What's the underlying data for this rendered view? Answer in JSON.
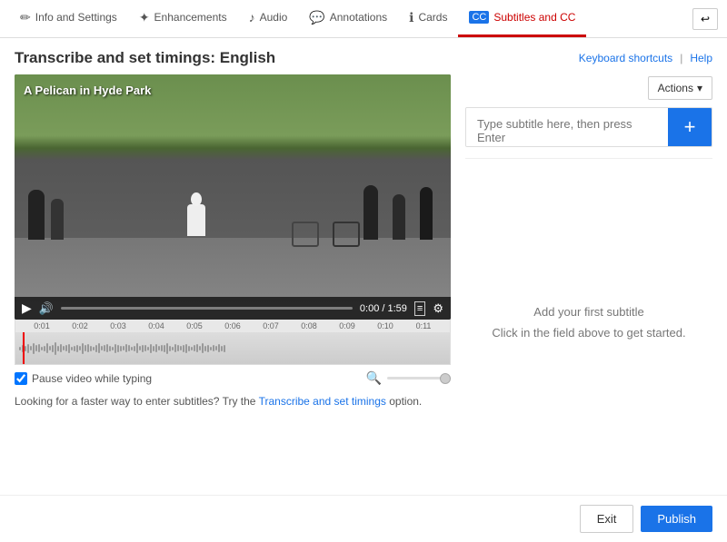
{
  "tabs": [
    {
      "id": "info",
      "label": "Info and Settings",
      "icon": "✏",
      "active": false
    },
    {
      "id": "enhancements",
      "label": "Enhancements",
      "icon": "✦",
      "active": false
    },
    {
      "id": "audio",
      "label": "Audio",
      "icon": "♪",
      "active": false
    },
    {
      "id": "annotations",
      "label": "Annotations",
      "icon": "💬",
      "active": false
    },
    {
      "id": "cards",
      "label": "Cards",
      "icon": "ℹ",
      "active": false
    },
    {
      "id": "subtitles",
      "label": "Subtitles and CC",
      "icon": "CC",
      "active": true
    }
  ],
  "back_button": "↩",
  "page_title": "Transcribe and set timings: English",
  "header_links": {
    "keyboard_shortcuts": "Keyboard shortcuts",
    "separator": "|",
    "help": "Help"
  },
  "video": {
    "title": "A Pelican in Hyde Park",
    "time_current": "0:00",
    "time_total": "1:59",
    "timeline_markers": [
      "0:01",
      "0:02",
      "0:03",
      "0:04",
      "0:05",
      "0:06",
      "0:07",
      "0:08",
      "0:09",
      "0:10",
      "0:11"
    ]
  },
  "controls": {
    "pause_while_typing_label": "Pause video while typing",
    "pause_checked": true
  },
  "transcribe_note": {
    "prefix": "Looking for a faster way to enter subtitles? Try the",
    "link_text": "Transcribe and set timings",
    "suffix": "option."
  },
  "right_panel": {
    "actions_label": "Actions",
    "actions_chevron": "▾",
    "subtitle_placeholder": "Type subtitle here, then press Enter",
    "add_button": "+",
    "empty_state_line1": "Add your first subtitle",
    "empty_state_line2": "Click in the field above to get started."
  },
  "bottom_bar": {
    "exit_label": "Exit",
    "publish_label": "Publish"
  }
}
